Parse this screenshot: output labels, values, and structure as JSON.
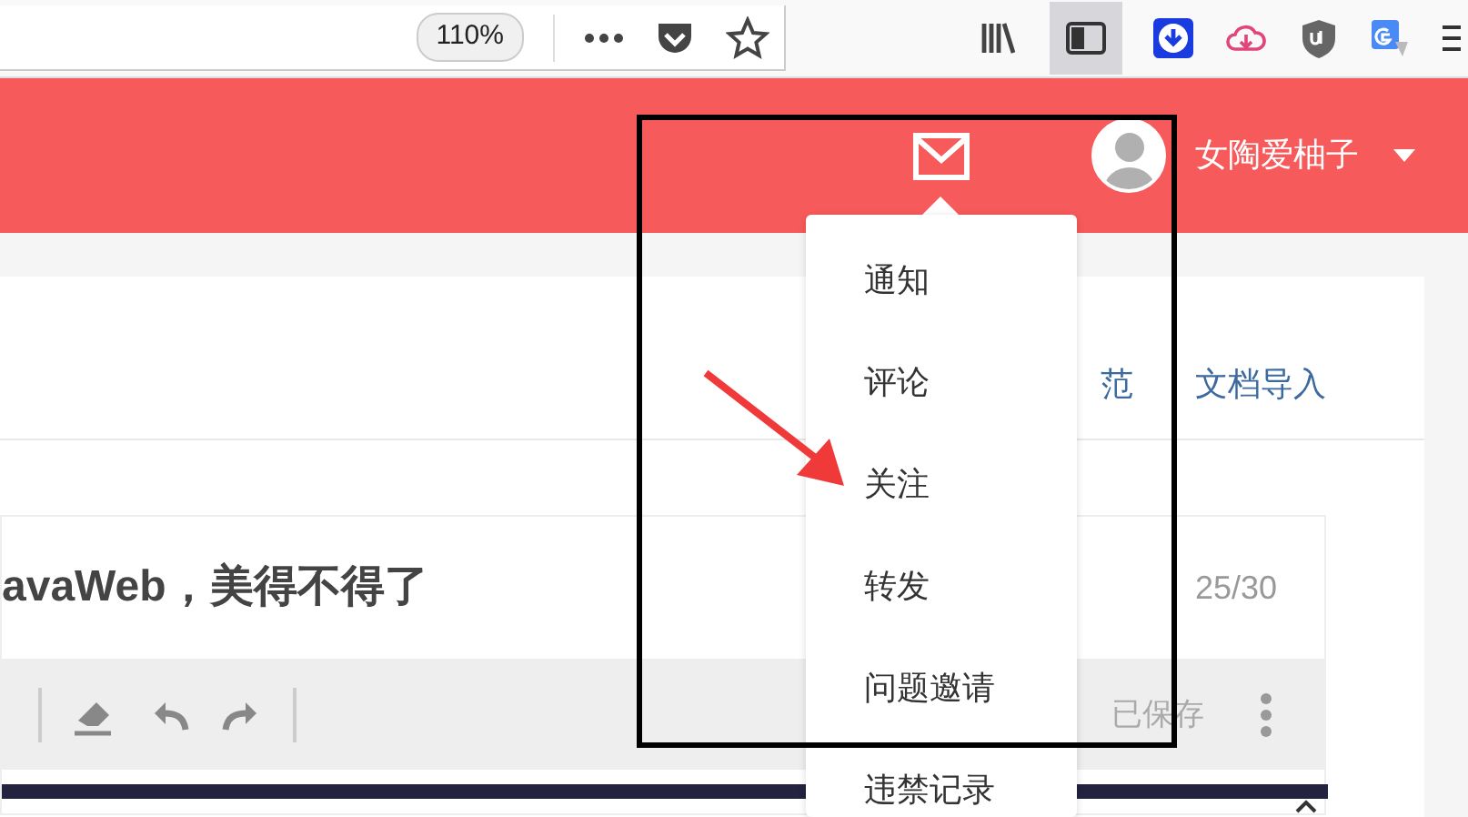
{
  "browser_toolbar": {
    "zoom": "110%"
  },
  "header": {
    "user_name": "女陶爱柚子"
  },
  "editor": {
    "tabs": [
      {
        "label": "范"
      },
      {
        "label": "文档导入"
      }
    ],
    "title": "avaWeb，美得不得了",
    "char_count": "25/30",
    "save_status": "已保存"
  },
  "notification_menu": {
    "items": [
      {
        "label": "通知"
      },
      {
        "label": "评论"
      },
      {
        "label": "关注"
      },
      {
        "label": "转发"
      },
      {
        "label": "问题邀请"
      },
      {
        "label": "违禁记录"
      }
    ]
  }
}
